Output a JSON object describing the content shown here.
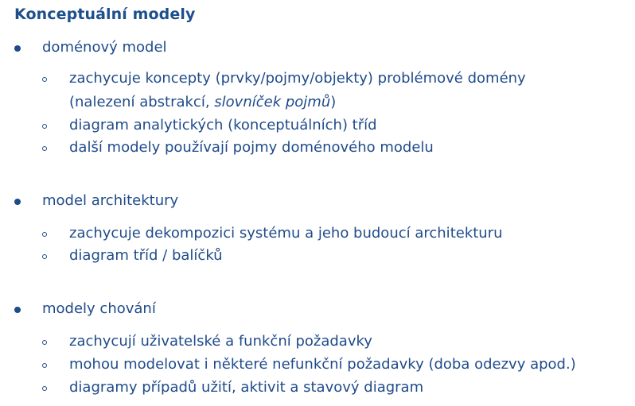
{
  "title": "Konceptuální modely",
  "sections": [
    {
      "label": "doménový model",
      "items": [
        {
          "line1": "zachycuje koncepty (prvky/pojmy/objekty) problémové domény",
          "line2_prefix": "(nalezení abstrakcí, ",
          "line2_italic": "slovníček pojmů",
          "line2_suffix": ")"
        },
        {
          "text": "diagram analytických (konceptuálních) tříd"
        },
        {
          "text": "další modely používají pojmy doménového modelu"
        }
      ]
    },
    {
      "label": "model architektury",
      "items": [
        {
          "text": "zachycuje dekompozici systému a jeho budoucí architekturu"
        },
        {
          "text": "diagram tříd / balíčků"
        }
      ]
    },
    {
      "label": "modely chování",
      "items": [
        {
          "text": "zachycují uživatelské a funkční požadavky"
        },
        {
          "text": "mohou modelovat i některé nefunkční požadavky (doba odezvy apod.)"
        },
        {
          "text": "diagramy případů užití, aktivit a stavový diagram"
        }
      ]
    }
  ]
}
